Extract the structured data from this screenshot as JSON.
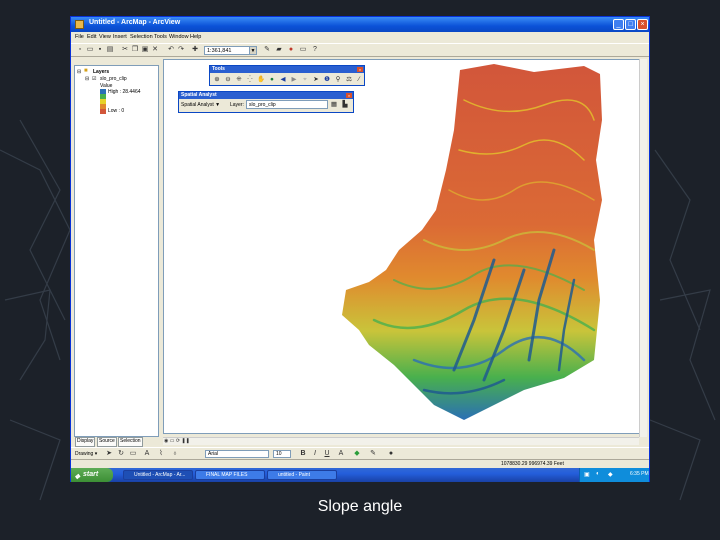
{
  "window": {
    "title": "Untitled - ArcMap - ArcView",
    "minimize": "_",
    "maximize": "□",
    "close": "×"
  },
  "menu": [
    "File",
    "Edit",
    "View",
    "Insert",
    "Selection",
    "Tools",
    "Window",
    "Help"
  ],
  "toolbar": {
    "scale": "1:361,841"
  },
  "toc": {
    "layers_label": "Layers",
    "layer_name": "slo_pro_clip",
    "value_label": "Value",
    "high_label": "High : 28.4464",
    "low_label": "Low : 0",
    "tabs": [
      "Display",
      "Source",
      "Selection"
    ]
  },
  "tools_window": {
    "title": "Tools"
  },
  "spatial_analyst": {
    "title": "Spatial Analyst",
    "menu_label": "Spatial Analyst ▼",
    "layer_label": "Layer:",
    "layer_value": "slo_pro_clip"
  },
  "drawing_bar": {
    "drawing_label": "Drawing ▾",
    "font": "Arial",
    "font_size": "10",
    "bold": "B",
    "italic": "I",
    "underline": "U",
    "text_a": "A"
  },
  "status": {
    "coordinates": "1078830.29  996974.39 Feet"
  },
  "taskbar": {
    "start": "start",
    "tasks": [
      "Untitled - ArcMap - Ar...",
      "FINAL MAP FILES",
      "untitled - Paint"
    ],
    "clock": "6:35 PM"
  },
  "legend_colors": {
    "high": "#2a6fb5",
    "mid": "#e6d32a",
    "low": "#d2563a"
  },
  "caption": "Slope angle"
}
